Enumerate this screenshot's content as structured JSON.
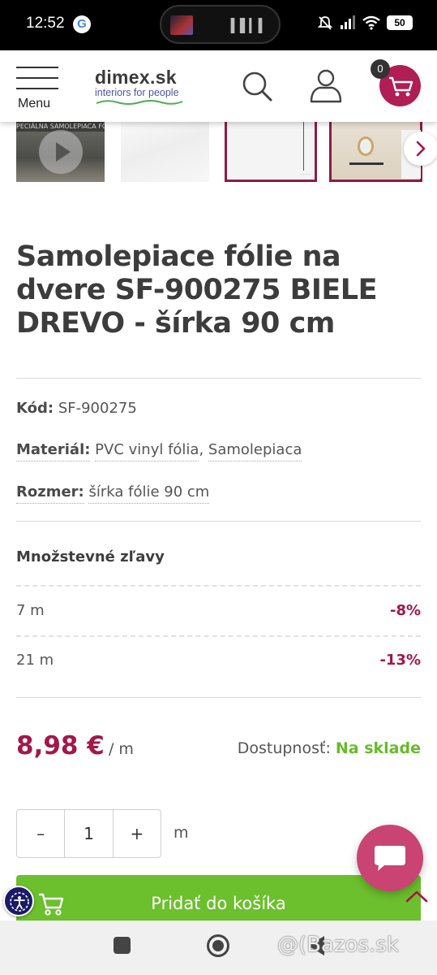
{
  "status_bar": {
    "time": "12:52",
    "google_badge": "G",
    "battery": "50"
  },
  "header": {
    "menu_label": "Menu",
    "logo_name": "dimex.sk",
    "logo_tagline": "interiors for people",
    "cart_count": "0"
  },
  "gallery": {
    "video_strip_text": "PECIÁLNA SAMOLEPIACA FÓLIA EX"
  },
  "product": {
    "title": "Samolepiace fólie na dvere SF-900275 BIELE DREVO - šírka 90 cm",
    "attributes": [
      {
        "label": "Kód:",
        "value": "SF-900275"
      },
      {
        "label": "Materiál:",
        "value": "PVC vinyl fólia, Samolepiaca"
      },
      {
        "label": "Rozmer:",
        "value": "šírka fólie 90 cm"
      }
    ],
    "material_values": [
      "PVC vinyl fólia",
      "Samolepiaca"
    ],
    "discounts_title": "Množstevné zľavy",
    "discounts": [
      {
        "qty": "7 m",
        "pct": "-8%"
      },
      {
        "qty": "21 m",
        "pct": "-13%"
      }
    ],
    "price": "8,98 €",
    "price_unit": "/ m",
    "availability_label": "Dostupnosť:",
    "availability_value": "Na sklade",
    "quantity": {
      "minus": "–",
      "value": "1",
      "plus": "+",
      "unit": "m"
    },
    "add_to_cart": "Pridať do košíka"
  },
  "watermark": "@(Bazos.sk",
  "colors": {
    "brand": "#a3174b",
    "cart": "#b01e54",
    "green": "#6cbf2d",
    "chat": "#c94472"
  },
  "icons": [
    "google-icon",
    "mute-icon",
    "signal-icon",
    "wifi-icon",
    "search-icon",
    "user-icon",
    "cart-icon",
    "play-icon",
    "chevron-right-icon",
    "chat-icon",
    "chevron-up-icon",
    "accessibility-icon"
  ]
}
